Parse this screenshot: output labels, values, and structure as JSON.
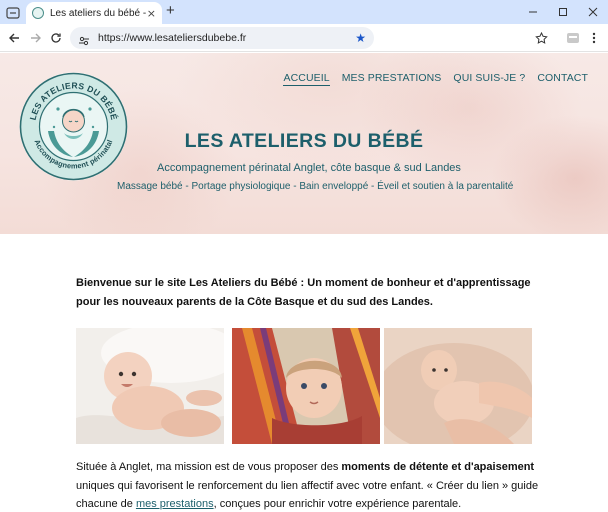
{
  "browser": {
    "tab_title": "Les ateliers du bébé - Accompa",
    "tab_close": "×",
    "new_tab": "+",
    "url": "https://www.lesateliersdubebe.fr"
  },
  "logo": {
    "ring_top_text": "LES ATELIERS DU BÉBÉ",
    "ring_bottom_text": "Accompagnement périnatal"
  },
  "nav": {
    "items": [
      {
        "label": "ACCUEIL"
      },
      {
        "label": "MES PRESTATIONS"
      },
      {
        "label": "QUI SUIS-JE ?"
      },
      {
        "label": "CONTACT"
      }
    ]
  },
  "hero": {
    "title": "LES ATELIERS DU BÉBÉ",
    "tagline": "Accompagnement périnatal Anglet, côte basque & sud Landes",
    "services": "Massage bébé - Portage physiologique - Bain enveloppé - Éveil et soutien à la parentalité"
  },
  "intro": {
    "text": "Bienvenue sur le site Les Ateliers du Bébé : Un moment de bonheur et d'apprentissage pour les nouveaux parents de la Côte Basque et du sud des Landes."
  },
  "body": {
    "p1_start": "Située à Anglet, ma mission est de vous proposer des ",
    "p1_bold": "moments de détente et d'apaisement",
    "p1_mid": " uniques qui favorisent le renforcement du lien affectif avec votre enfant. « Créer du lien » guide chacune de ",
    "p1_link": "mes prestations",
    "p1_end": ", conçues pour enrichir votre expérience parentale."
  },
  "colors": {
    "brand_teal": "#1d5f6b",
    "logo_teal": "#4b9a96",
    "chrome_tab_bar": "#d3e3fd"
  }
}
